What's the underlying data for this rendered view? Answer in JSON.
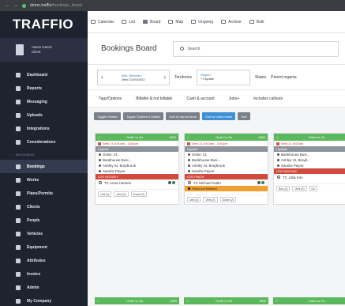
{
  "browser": {
    "url_domain": "demo.traffio",
    "url_rest": "/bookings_board"
  },
  "app": {
    "logo": "TRAFFIO"
  },
  "user": {
    "line1": "Aaron Carrol",
    "line2": "Client"
  },
  "sidebar": {
    "items_top": [
      {
        "label": "Dashboard"
      },
      {
        "label": "Reports"
      },
      {
        "label": "Messaging"
      },
      {
        "label": "Uploads"
      },
      {
        "label": "Integrations"
      },
      {
        "label": "Considerations"
      }
    ],
    "section": "BOOKINGS",
    "items_bottom": [
      {
        "label": "Bookings"
      },
      {
        "label": "Works"
      },
      {
        "label": "Plans/Permits"
      },
      {
        "label": "Clients"
      },
      {
        "label": "People"
      },
      {
        "label": "Vehicles"
      },
      {
        "label": "Equipment"
      },
      {
        "label": "Attributes"
      },
      {
        "label": "Invoice"
      },
      {
        "label": "Admin"
      },
      {
        "label": "My Company"
      }
    ]
  },
  "topnav": [
    {
      "label": "Calendar"
    },
    {
      "label": "List"
    },
    {
      "label": "Board"
    },
    {
      "label": "Map"
    },
    {
      "label": "Ongoing"
    },
    {
      "label": "Archive"
    },
    {
      "label": "Bulk"
    }
  ],
  "header": {
    "title": "Bookings Board",
    "search_placeholder": "Search"
  },
  "filters": {
    "date_label": "Bkd. Between",
    "date_value": "Wed 21/09/2022",
    "territories": "Territories",
    "region_label": "Region",
    "region_value": "+ Lilydale",
    "states": "States",
    "parent": "Parent organis"
  },
  "tags": [
    "Tags/Options",
    "Billable & not billable",
    "Cash & account",
    "Jobs+",
    "Includes callouts"
  ],
  "toggle_buttons": [
    {
      "label": "Toggle Header"
    },
    {
      "label": "Toggle Shipment Details"
    },
    {
      "label": "Sort by depot name"
    },
    {
      "label": "Sort by client name"
    },
    {
      "label": "Sort"
    }
  ],
  "cards": [
    {
      "status": "Order to Go",
      "code": "1850",
      "time": "Wed 21 6:00am - 3:00pm",
      "depot": "Lilydale",
      "lines": [
        "Order: 21",
        "Bankhouse Busi...",
        "Ashley St, Braybrook",
        "Sandra Payne"
      ],
      "crew": "UTE ROSSEY",
      "person": "TC Anna Hansen",
      "orange": "",
      "foot": [
        "Unit (2)",
        "Vehi (2)",
        "Dome (2)"
      ]
    },
    {
      "status": "Order to Go",
      "code": "1852",
      "time": "Wed 21 6:00am - 3:00pm",
      "depot": "Lilydale",
      "lines": [
        "Order: 21",
        "Bankhouse Busi...",
        "Ashley St, Braybrook",
        "Sandra Payne"
      ],
      "crew": "UTE FINCH",
      "person": "TC Michael Gatto",
      "orange": "Plans not finished",
      "foot": [
        "Unit (2)",
        "Vehi (2)",
        "Dome (2)"
      ]
    },
    {
      "status": "Order to Go",
      "code": "",
      "time": "Wed 21 6:00am",
      "depot": "Lilydale",
      "lines": [
        "Bankhouse Busi...",
        "Ashley St, Brayb...",
        "Sandra Payne"
      ],
      "crew": "UTE BROOKE",
      "person": "TC Julia Kim",
      "orange": "",
      "foot": [
        "Boo (2)",
        "Vehi (2)",
        "Do"
      ]
    }
  ],
  "cards_bottom": [
    {
      "status": "Order to Go",
      "code": "1850"
    },
    {
      "status": "Order to Go",
      "code": "1852"
    },
    {
      "status": "Order to Go",
      "code": ""
    }
  ],
  "colors": {
    "sidebar": "#1e2330",
    "status_green": "#5cb85c",
    "crew_red": "#d14a3e",
    "warn_orange": "#f0a030",
    "accent_blue": "#3d8fd6"
  }
}
